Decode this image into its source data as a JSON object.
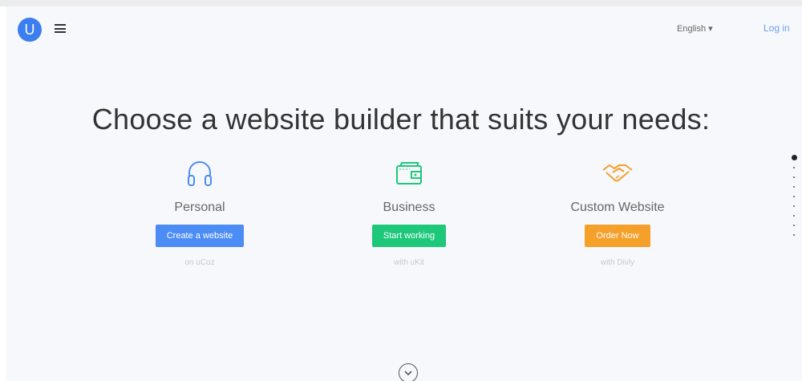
{
  "header": {
    "logo_letter": "U",
    "language": "English ▾",
    "login": "Log in"
  },
  "headline": "Choose a website builder that suits your needs:",
  "cards": [
    {
      "title": "Personal",
      "button": "Create a website",
      "sub": "on uCoz",
      "color": "#4c8cf5",
      "icon": "headphones-icon"
    },
    {
      "title": "Business",
      "button": "Start working",
      "sub": "with uKit",
      "color": "#1ec87a",
      "icon": "wallet-icon"
    },
    {
      "title": "Custom Website",
      "button": "Order Now",
      "sub": "with Divly",
      "color": "#f5a02a",
      "icon": "handshake-icon"
    }
  ],
  "colors": {
    "accent": "#3b7ef0",
    "background": "#f7f8fb"
  }
}
